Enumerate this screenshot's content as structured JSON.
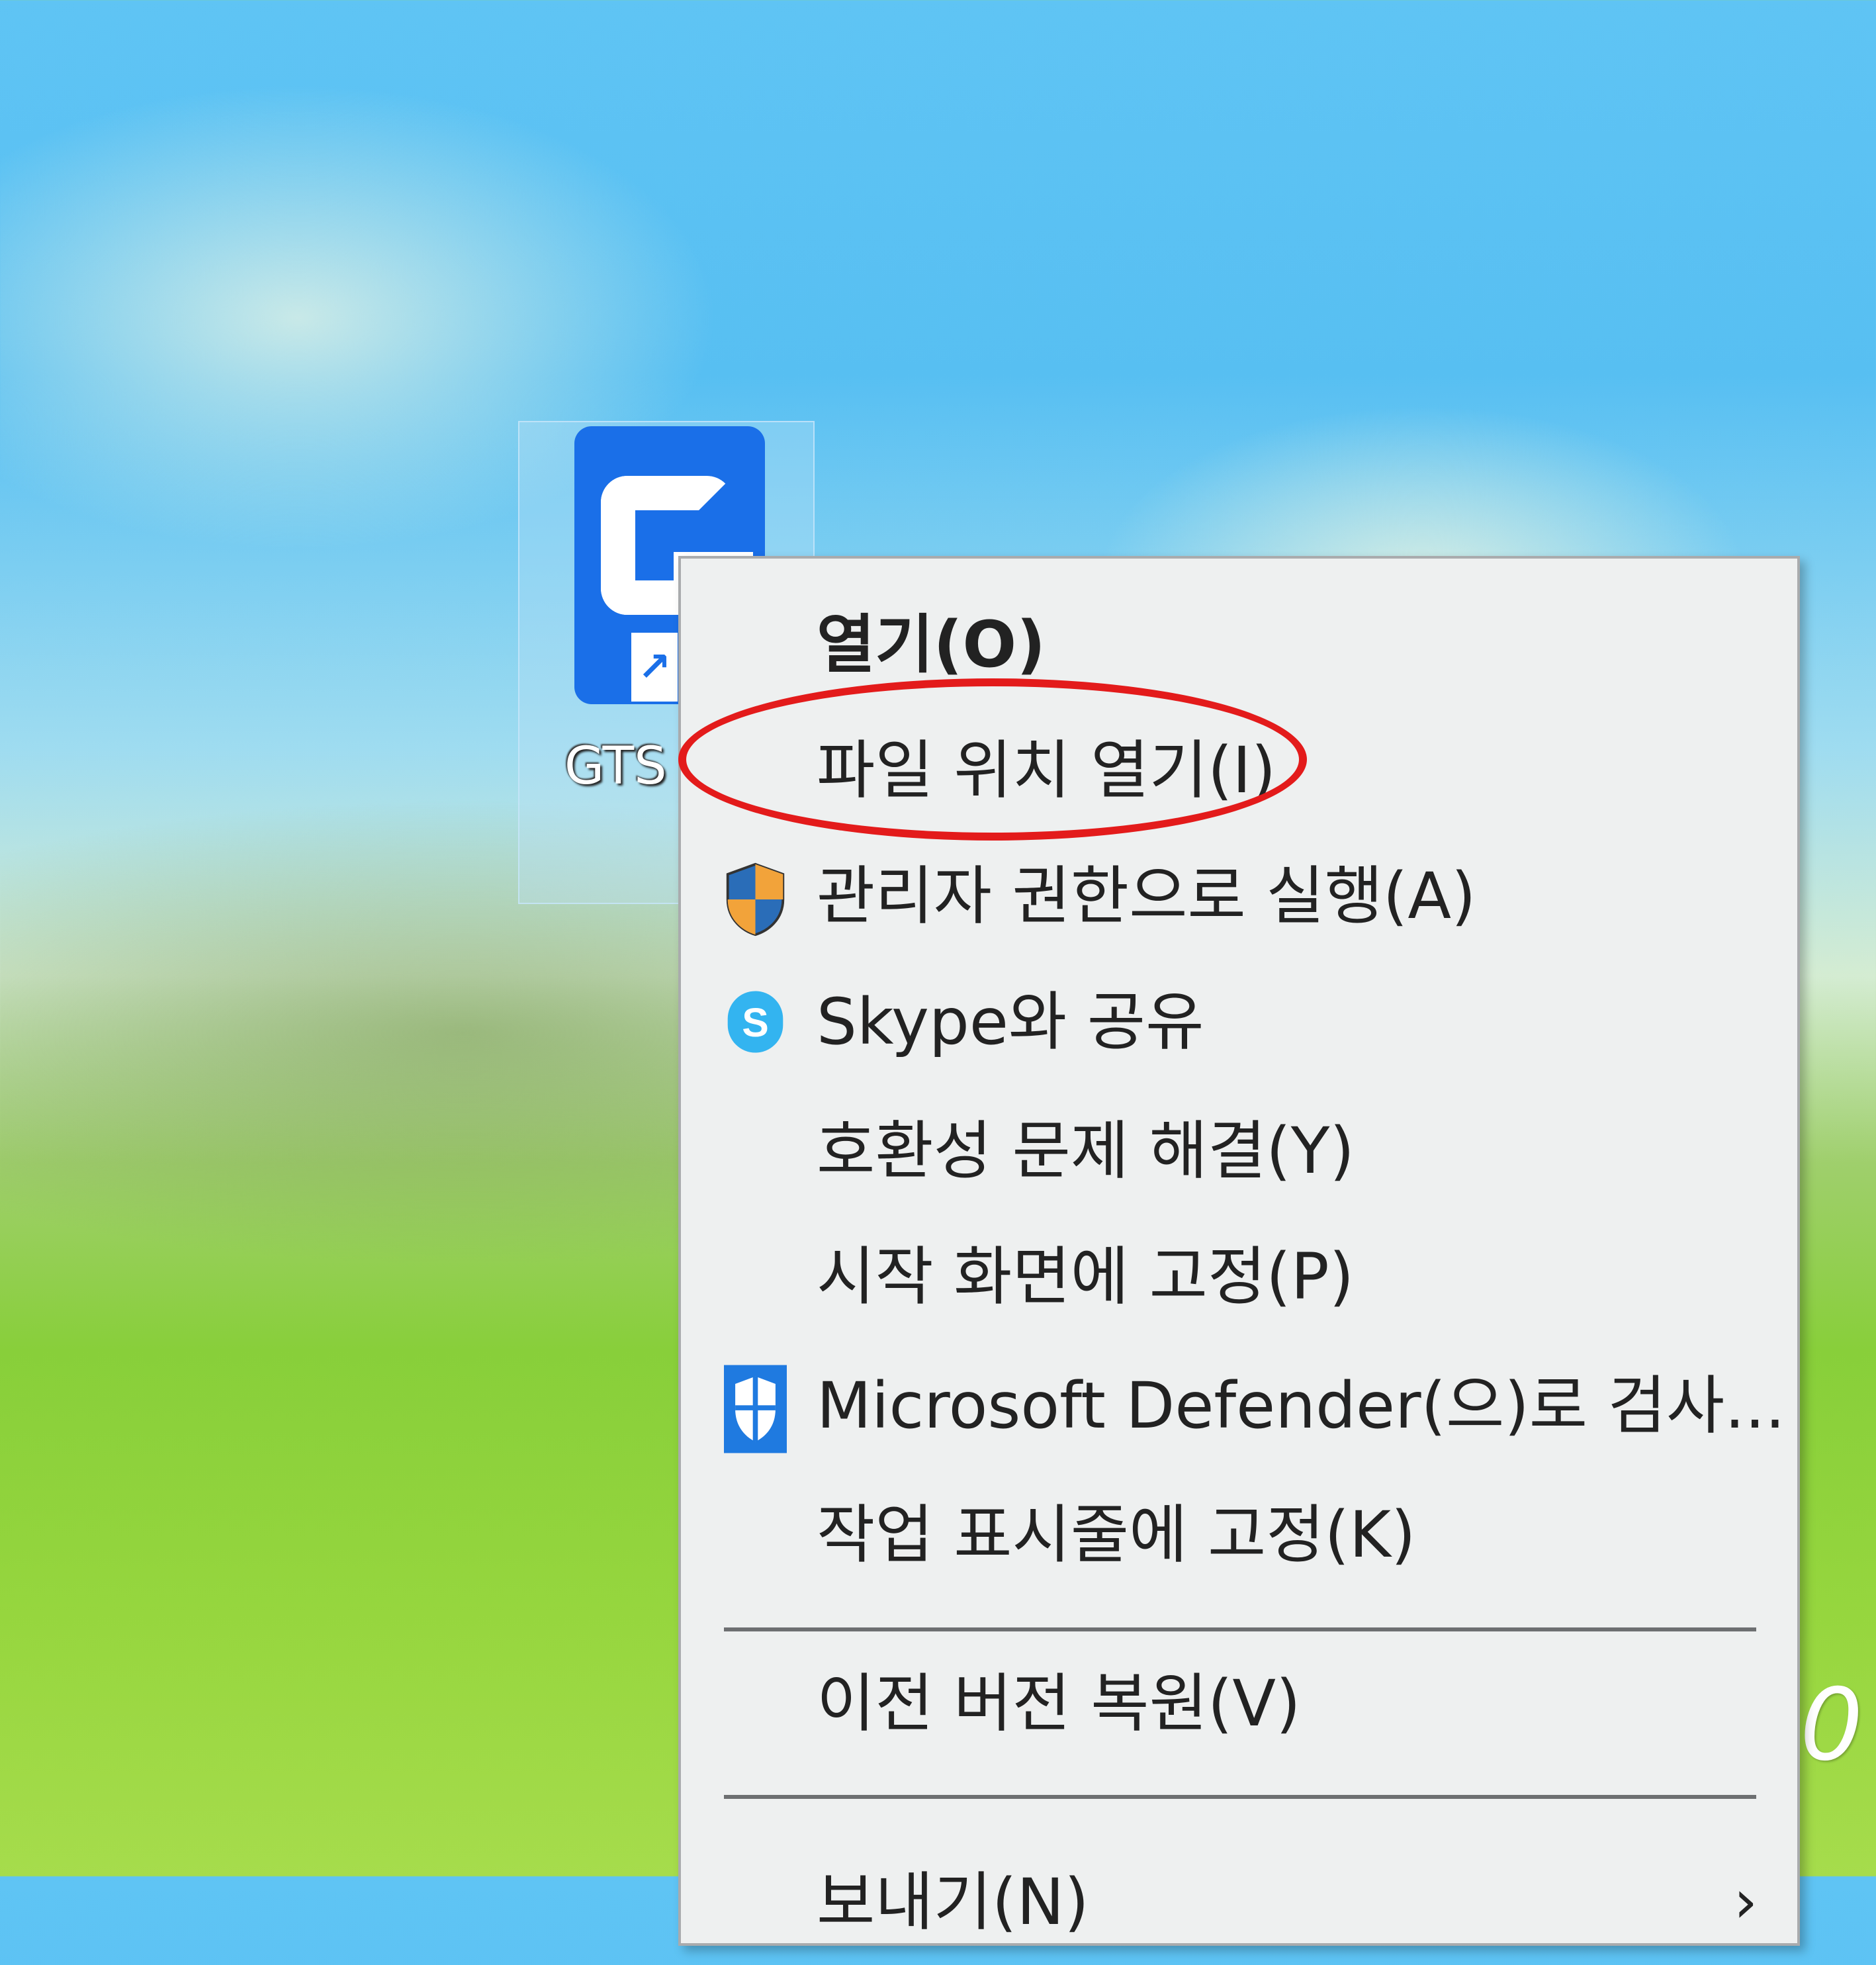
{
  "desktop": {
    "shortcut_label": "GTS - 가",
    "edge_text": "0"
  },
  "context_menu": {
    "items": [
      {
        "label": "열기(O)",
        "icon": ""
      },
      {
        "label": "파일 위치 열기(I)",
        "icon": ""
      },
      {
        "label": "관리자 권한으로 실행(A)",
        "icon": "uac-shield-icon"
      },
      {
        "label": "Skype와 공유",
        "icon": "skype-icon"
      },
      {
        "label": "호환성 문제 해결(Y)",
        "icon": ""
      },
      {
        "label": "시작 화면에 고정(P)",
        "icon": ""
      },
      {
        "label": "Microsoft Defender(으)로 검사...",
        "icon": "defender-icon"
      },
      {
        "label": "작업 표시줄에 고정(K)",
        "icon": ""
      },
      {
        "label": "이전 버전 복원(V)",
        "icon": ""
      },
      {
        "label": "보내기(N)",
        "icon": "chevron-right-icon"
      }
    ]
  },
  "colors": {
    "highlight": "#e31b1b",
    "menu_bg": "#eef0f0",
    "app_icon_bg": "#1a6fe8"
  }
}
